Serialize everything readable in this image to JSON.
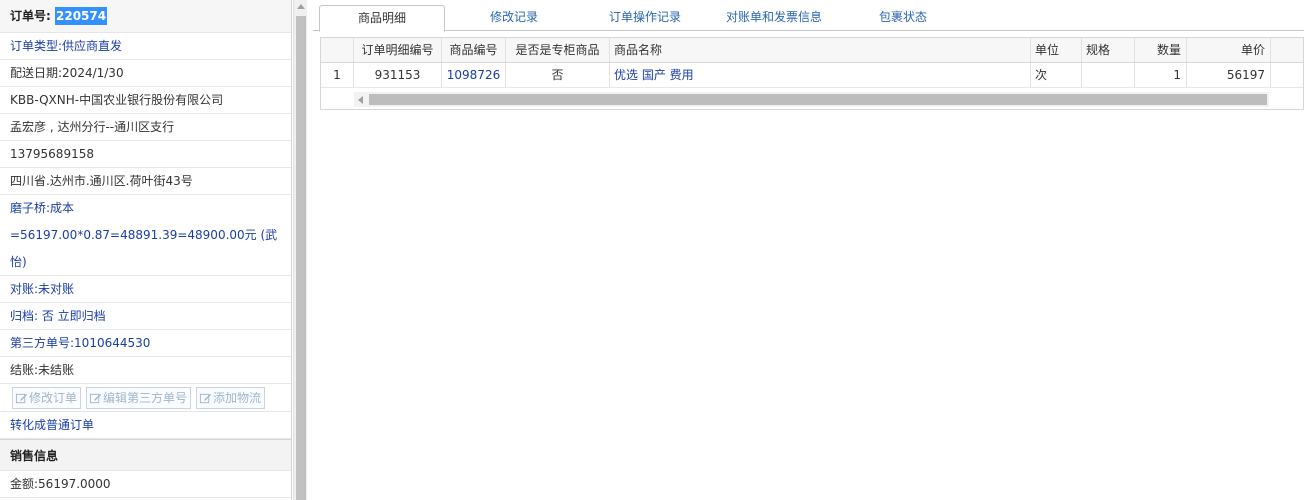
{
  "left": {
    "order_label": "订单号:",
    "order_no": "220574",
    "order_type": "订单类型:供应商直发",
    "delivery_date": "配送日期:2024/1/30",
    "company": "KBB-QXNH-中国农业银行股份有限公司",
    "contact": "孟宏彦 , 达州分行--通川区支行",
    "phone": "13795689158",
    "address": "四川省.达州市.通川区.荷叶街43号",
    "cost_line1": "磨子桥:成本",
    "cost_line2": "=56197.00*0.87=48891.39=48900.00元 (武",
    "cost_line3": "怡)",
    "reconcile": "对账:未对账",
    "archive": "归档: 否 立即归档",
    "third_party": "第三方单号:1010644530",
    "settle": "结账:未结账",
    "buttons": {
      "edit_order": "修改订单",
      "edit_third": "编辑第三方单号",
      "add_logistics": "添加物流"
    },
    "convert": "转化成普通订单",
    "sales_title": "销售信息",
    "amount": "金额:56197.0000"
  },
  "tabs": [
    "商品明细",
    "修改记录",
    "订单操作记录",
    "对账单和发票信息",
    "包裹状态"
  ],
  "grid": {
    "headers": [
      "订单明细编号",
      "商品编号",
      "是否是专柜商品",
      "商品名称",
      "单位",
      "规格",
      "数量",
      "单价"
    ],
    "rows": [
      {
        "index": "1",
        "detail_no": "931153",
        "product_no": "1098726",
        "is_counter": "否",
        "product_name": "优选 国产 费用",
        "unit": "次",
        "spec": "",
        "qty": "1",
        "price": "56197"
      }
    ]
  },
  "colors": {
    "link": "#1a3ea8",
    "tab_text": "#2a66b3",
    "highlight": "#3390ff"
  }
}
